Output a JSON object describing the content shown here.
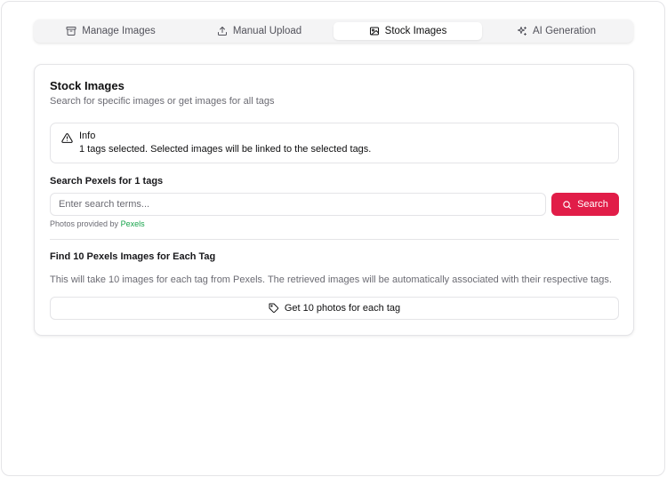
{
  "tabs": [
    {
      "label": "Manage Images",
      "icon": "archive-icon"
    },
    {
      "label": "Manual Upload",
      "icon": "upload-icon"
    },
    {
      "label": "Stock Images",
      "icon": "image-icon"
    },
    {
      "label": "AI Generation",
      "icon": "sparkles-icon"
    }
  ],
  "active_tab": "Stock Images",
  "card": {
    "title": "Stock Images",
    "description": "Search for specific images or get images for all tags"
  },
  "alert": {
    "title": "Info",
    "text": "1 tags selected. Selected images will be linked to the selected tags."
  },
  "search": {
    "label": "Search Pexels for 1 tags",
    "placeholder": "Enter search terms...",
    "value": "",
    "button_label": "Search",
    "credit_prefix": "Photos provided by",
    "credit_link": "Pexels"
  },
  "bulk": {
    "label": "Find 10 Pexels Images for Each Tag",
    "description": "This will take 10 images for each tag from Pexels. The retrieved images will be automatically associated with their respective tags.",
    "button_label": "Get 10 photos for each tag"
  },
  "colors": {
    "accent": "#e11d48",
    "link": "#16a34a"
  }
}
